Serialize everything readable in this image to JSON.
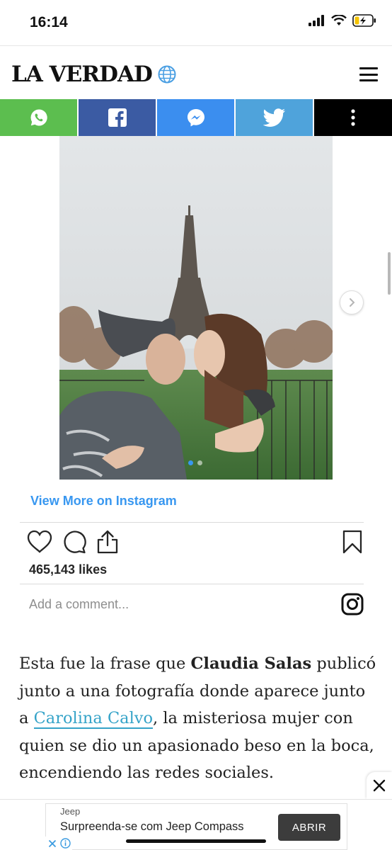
{
  "status_bar": {
    "time": "16:14"
  },
  "header": {
    "brand": "LA VERDAD"
  },
  "share": {
    "colors": {
      "whatsapp": "#5cbe4f",
      "facebook": "#3b5ba3",
      "messenger": "#3b8eef",
      "twitter": "#4fa3db",
      "more": "#000000"
    }
  },
  "instagram": {
    "view_more": "View More on Instagram",
    "likes": "465,143 likes",
    "comment_placeholder": "Add a comment...",
    "carousel": {
      "total": 2,
      "active": 1
    }
  },
  "article": {
    "p1": "Esta fue la frase que ",
    "name1": "Claudia Salas",
    "p2": " publicó junto a una fotografía donde aparece junto a ",
    "link": "Carolina Calvo",
    "p3": ", la misteriosa mujer con quien se dio un apasionado beso en la boca, encendiendo las redes sociales."
  },
  "ad": {
    "brand": "Jeep",
    "title": "Surpreenda-se com Jeep Compass",
    "cta": "ABRIR"
  }
}
